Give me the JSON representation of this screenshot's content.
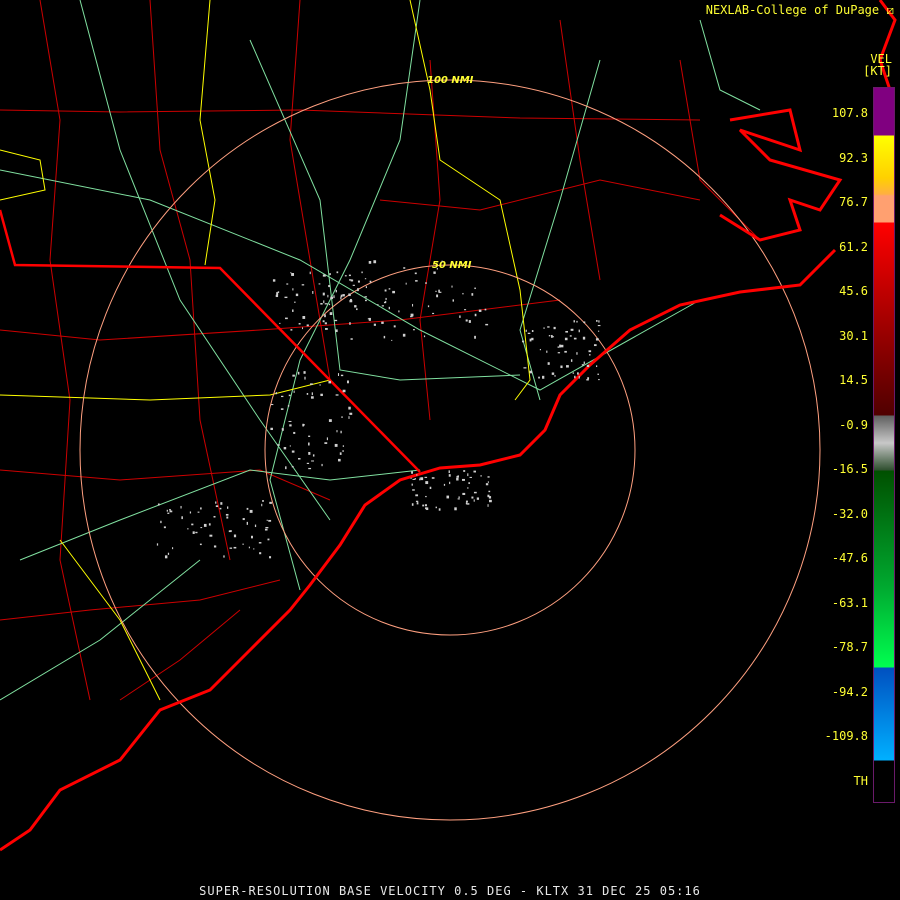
{
  "header": {
    "credit": "NEXLAB-College of DuPage",
    "product": "VEL",
    "unit": "[KT]"
  },
  "legend": {
    "ticks": [
      "107.8",
      "92.3",
      "76.7",
      "61.2",
      "45.6",
      "30.1",
      "14.5",
      "-0.9",
      "-16.5",
      "-32.0",
      "-47.6",
      "-63.1",
      "-78.7",
      "-94.2",
      "-109.8",
      "TH"
    ],
    "colors": {
      "purple": "#800080",
      "yellow": "#ffff00",
      "orange": "#ffa070",
      "red": "#ff0000",
      "gray": "#c8c8c8",
      "green": "#00aa30",
      "blue": "#0070d0"
    }
  },
  "map": {
    "rings": [
      {
        "label": "50 NMI"
      },
      {
        "label": "100 NMI"
      }
    ],
    "colors": {
      "coast": "#ff0000",
      "counties": "#cc0000",
      "roads": "#80e0a0",
      "interstates": "#ffff00",
      "rings": "#ffa080"
    }
  },
  "footer": {
    "title": "SUPER-RESOLUTION BASE VELOCITY 0.5 DEG - KLTX 31 DEC 25 05:16"
  }
}
